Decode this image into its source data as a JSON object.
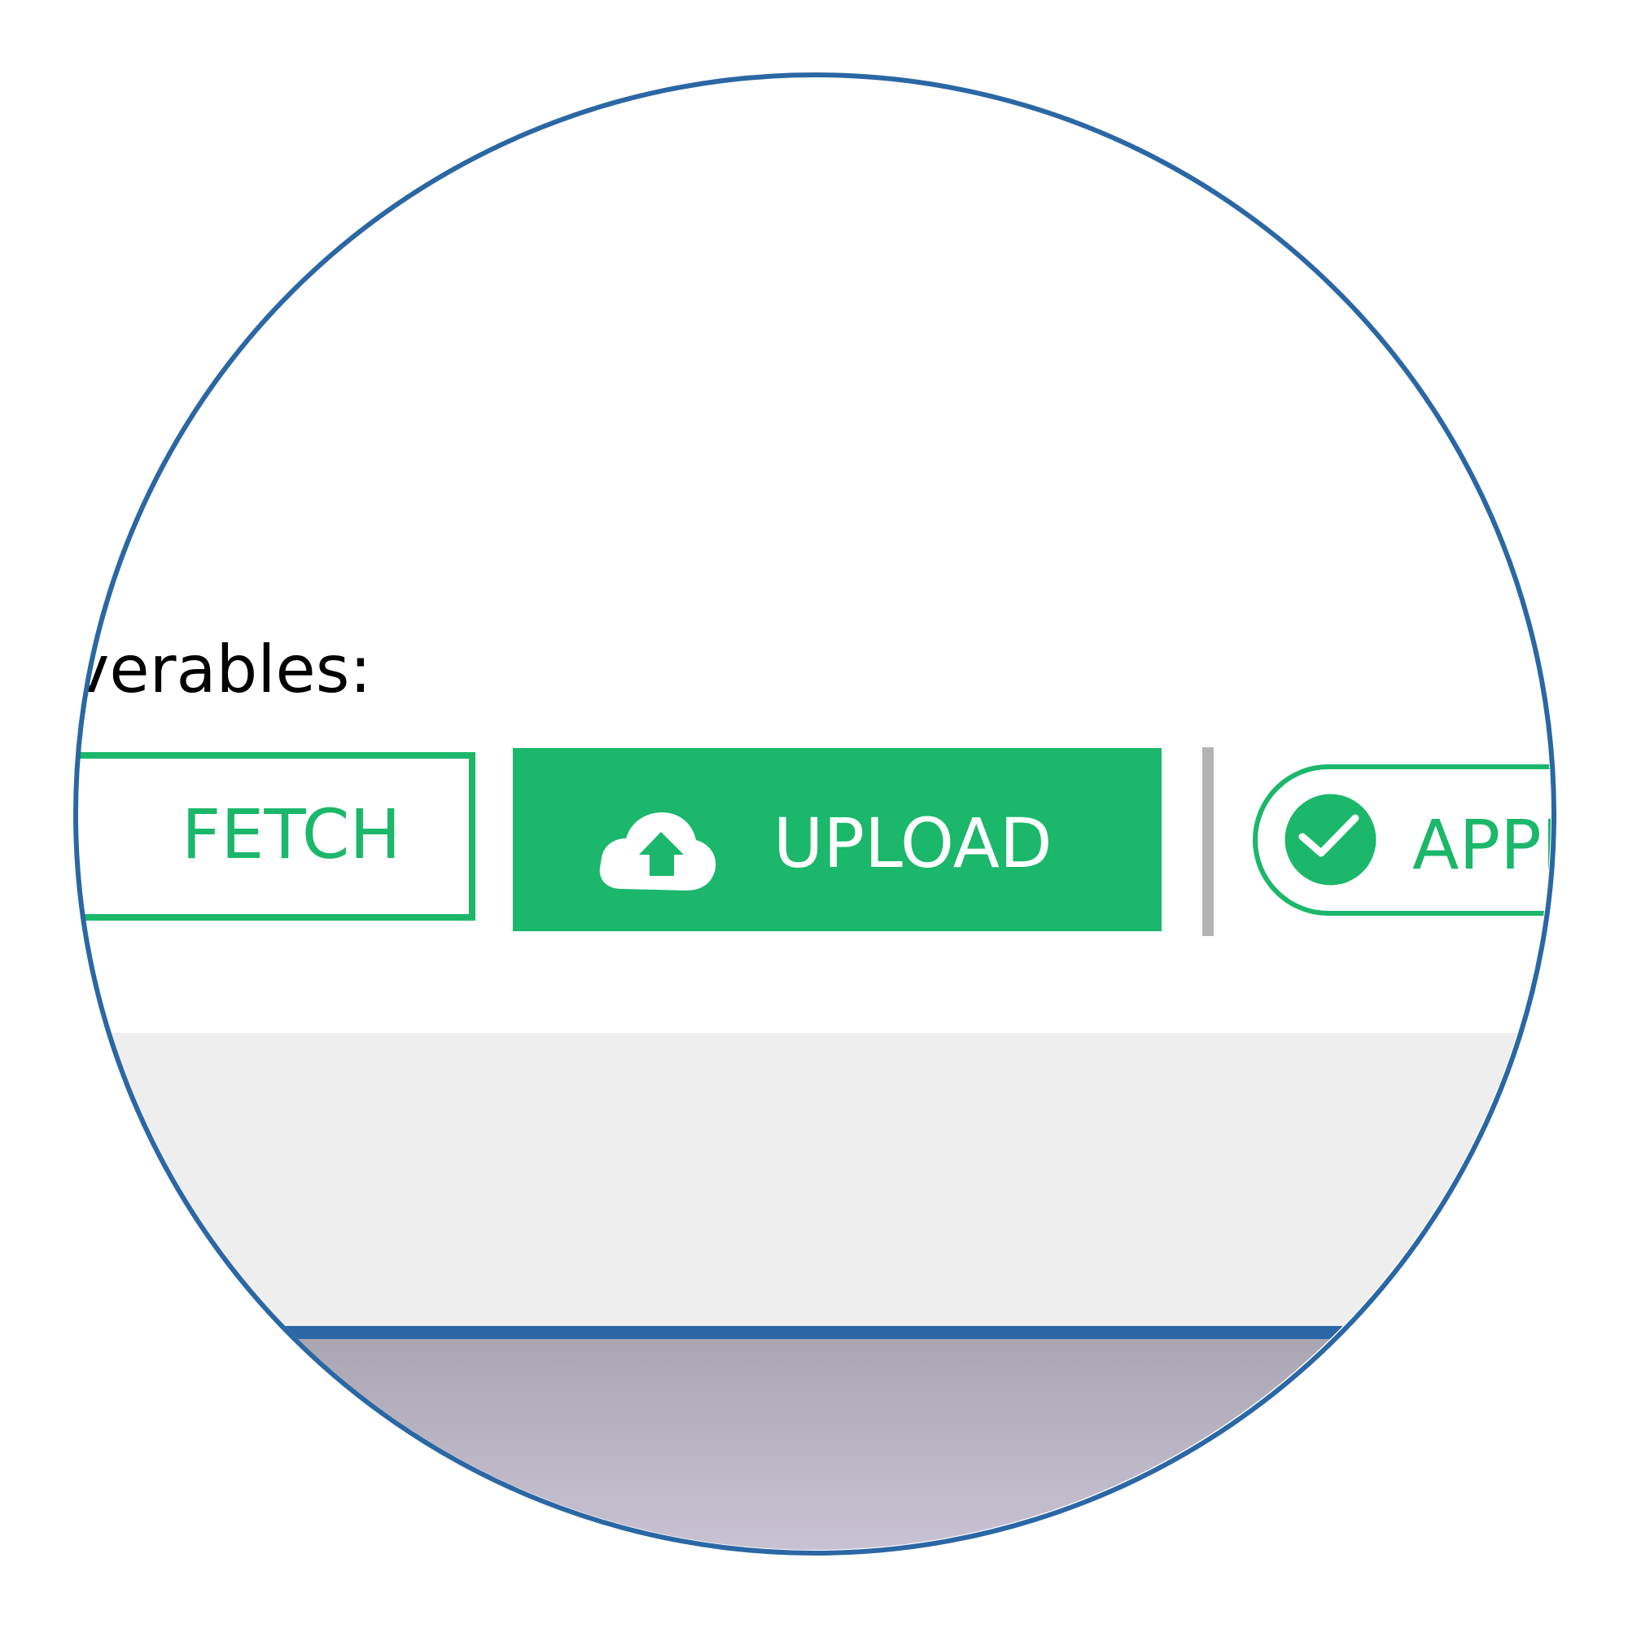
{
  "section": {
    "label": "verables:"
  },
  "toolbar": {
    "fetch_label": "FETCH",
    "upload_label": "UPLOAD",
    "approve_label": "APPR"
  },
  "icons": {
    "upload": "cloud-upload-icon",
    "approve": "check-circle-icon"
  },
  "colors": {
    "accent_green": "#1bb76a",
    "lens_border": "#2a67a4",
    "divider": "#b3b3b3",
    "panel_grey": "#eeeeee"
  }
}
